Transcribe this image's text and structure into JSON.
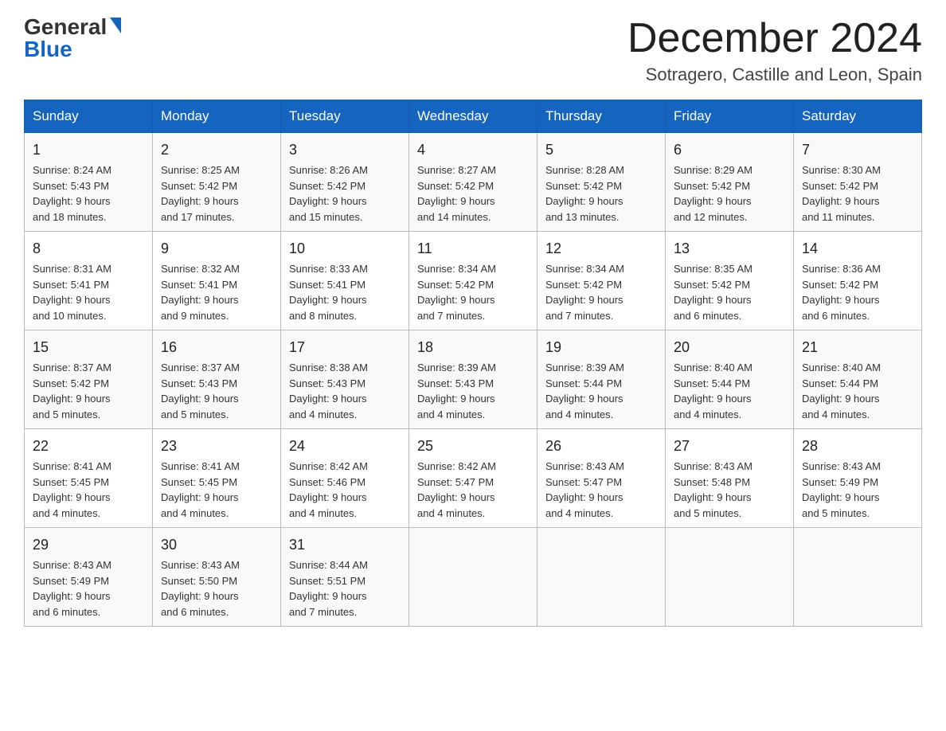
{
  "header": {
    "logo": {
      "general": "General",
      "blue": "Blue",
      "aria": "GeneralBlue logo"
    },
    "title": "December 2024",
    "location": "Sotragero, Castille and Leon, Spain"
  },
  "calendar": {
    "days": [
      "Sunday",
      "Monday",
      "Tuesday",
      "Wednesday",
      "Thursday",
      "Friday",
      "Saturday"
    ],
    "weeks": [
      [
        {
          "day": "1",
          "info": "Sunrise: 8:24 AM\nSunset: 5:43 PM\nDaylight: 9 hours\nand 18 minutes."
        },
        {
          "day": "2",
          "info": "Sunrise: 8:25 AM\nSunset: 5:42 PM\nDaylight: 9 hours\nand 17 minutes."
        },
        {
          "day": "3",
          "info": "Sunrise: 8:26 AM\nSunset: 5:42 PM\nDaylight: 9 hours\nand 15 minutes."
        },
        {
          "day": "4",
          "info": "Sunrise: 8:27 AM\nSunset: 5:42 PM\nDaylight: 9 hours\nand 14 minutes."
        },
        {
          "day": "5",
          "info": "Sunrise: 8:28 AM\nSunset: 5:42 PM\nDaylight: 9 hours\nand 13 minutes."
        },
        {
          "day": "6",
          "info": "Sunrise: 8:29 AM\nSunset: 5:42 PM\nDaylight: 9 hours\nand 12 minutes."
        },
        {
          "day": "7",
          "info": "Sunrise: 8:30 AM\nSunset: 5:42 PM\nDaylight: 9 hours\nand 11 minutes."
        }
      ],
      [
        {
          "day": "8",
          "info": "Sunrise: 8:31 AM\nSunset: 5:41 PM\nDaylight: 9 hours\nand 10 minutes."
        },
        {
          "day": "9",
          "info": "Sunrise: 8:32 AM\nSunset: 5:41 PM\nDaylight: 9 hours\nand 9 minutes."
        },
        {
          "day": "10",
          "info": "Sunrise: 8:33 AM\nSunset: 5:41 PM\nDaylight: 9 hours\nand 8 minutes."
        },
        {
          "day": "11",
          "info": "Sunrise: 8:34 AM\nSunset: 5:42 PM\nDaylight: 9 hours\nand 7 minutes."
        },
        {
          "day": "12",
          "info": "Sunrise: 8:34 AM\nSunset: 5:42 PM\nDaylight: 9 hours\nand 7 minutes."
        },
        {
          "day": "13",
          "info": "Sunrise: 8:35 AM\nSunset: 5:42 PM\nDaylight: 9 hours\nand 6 minutes."
        },
        {
          "day": "14",
          "info": "Sunrise: 8:36 AM\nSunset: 5:42 PM\nDaylight: 9 hours\nand 6 minutes."
        }
      ],
      [
        {
          "day": "15",
          "info": "Sunrise: 8:37 AM\nSunset: 5:42 PM\nDaylight: 9 hours\nand 5 minutes."
        },
        {
          "day": "16",
          "info": "Sunrise: 8:37 AM\nSunset: 5:43 PM\nDaylight: 9 hours\nand 5 minutes."
        },
        {
          "day": "17",
          "info": "Sunrise: 8:38 AM\nSunset: 5:43 PM\nDaylight: 9 hours\nand 4 minutes."
        },
        {
          "day": "18",
          "info": "Sunrise: 8:39 AM\nSunset: 5:43 PM\nDaylight: 9 hours\nand 4 minutes."
        },
        {
          "day": "19",
          "info": "Sunrise: 8:39 AM\nSunset: 5:44 PM\nDaylight: 9 hours\nand 4 minutes."
        },
        {
          "day": "20",
          "info": "Sunrise: 8:40 AM\nSunset: 5:44 PM\nDaylight: 9 hours\nand 4 minutes."
        },
        {
          "day": "21",
          "info": "Sunrise: 8:40 AM\nSunset: 5:44 PM\nDaylight: 9 hours\nand 4 minutes."
        }
      ],
      [
        {
          "day": "22",
          "info": "Sunrise: 8:41 AM\nSunset: 5:45 PM\nDaylight: 9 hours\nand 4 minutes."
        },
        {
          "day": "23",
          "info": "Sunrise: 8:41 AM\nSunset: 5:45 PM\nDaylight: 9 hours\nand 4 minutes."
        },
        {
          "day": "24",
          "info": "Sunrise: 8:42 AM\nSunset: 5:46 PM\nDaylight: 9 hours\nand 4 minutes."
        },
        {
          "day": "25",
          "info": "Sunrise: 8:42 AM\nSunset: 5:47 PM\nDaylight: 9 hours\nand 4 minutes."
        },
        {
          "day": "26",
          "info": "Sunrise: 8:43 AM\nSunset: 5:47 PM\nDaylight: 9 hours\nand 4 minutes."
        },
        {
          "day": "27",
          "info": "Sunrise: 8:43 AM\nSunset: 5:48 PM\nDaylight: 9 hours\nand 5 minutes."
        },
        {
          "day": "28",
          "info": "Sunrise: 8:43 AM\nSunset: 5:49 PM\nDaylight: 9 hours\nand 5 minutes."
        }
      ],
      [
        {
          "day": "29",
          "info": "Sunrise: 8:43 AM\nSunset: 5:49 PM\nDaylight: 9 hours\nand 6 minutes."
        },
        {
          "day": "30",
          "info": "Sunrise: 8:43 AM\nSunset: 5:50 PM\nDaylight: 9 hours\nand 6 minutes."
        },
        {
          "day": "31",
          "info": "Sunrise: 8:44 AM\nSunset: 5:51 PM\nDaylight: 9 hours\nand 7 minutes."
        },
        {
          "day": "",
          "info": ""
        },
        {
          "day": "",
          "info": ""
        },
        {
          "day": "",
          "info": ""
        },
        {
          "day": "",
          "info": ""
        }
      ]
    ]
  }
}
